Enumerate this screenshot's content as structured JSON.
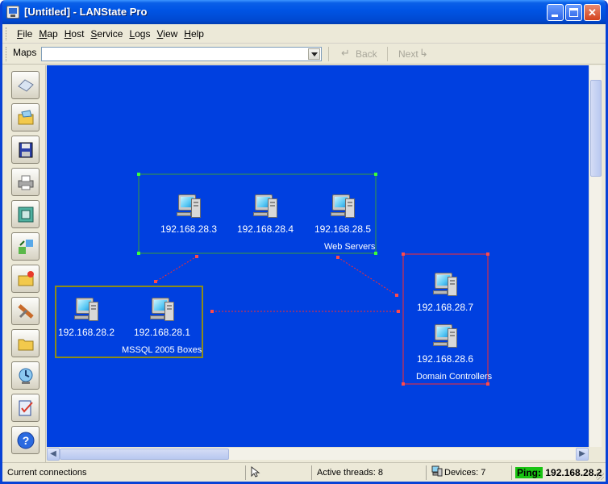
{
  "window": {
    "title": "[Untitled] - LANState Pro"
  },
  "menu": {
    "items": [
      {
        "accel": "F",
        "rest": "ile"
      },
      {
        "accel": "M",
        "rest": "ap"
      },
      {
        "accel": "H",
        "rest": "ost"
      },
      {
        "accel": "S",
        "rest": "ervice"
      },
      {
        "accel": "L",
        "rest": "ogs"
      },
      {
        "accel": "V",
        "rest": "iew"
      },
      {
        "accel": "H",
        "rest": "elp"
      }
    ]
  },
  "mapsbar": {
    "label": "Maps",
    "combo_value": "",
    "back_label": "Back",
    "next_label": "Next"
  },
  "toolbar": {
    "tools": [
      "new-map-icon",
      "open-map-icon",
      "save-map-icon",
      "print-icon",
      "fit-window-icon",
      "refresh-icon",
      "add-host-icon",
      "tools-icon",
      "folder-icon",
      "scan-network-icon",
      "checklist-icon",
      "help-icon"
    ]
  },
  "map": {
    "background": "#0040e0",
    "groups": [
      {
        "name": "Web Servers",
        "border_color": "#3a9b3a",
        "hosts": [
          "192.168.28.3",
          "192.168.28.4",
          "192.168.28.5"
        ]
      },
      {
        "name": "MSSQL 2005 Boxes",
        "border_color": "#8c8c18",
        "hosts": [
          "192.168.28.2",
          "192.168.28.1"
        ]
      },
      {
        "name": "Domain Controllers",
        "border_color": "#ff2a2a",
        "hosts": [
          "192.168.28.7",
          "192.168.28.6"
        ]
      }
    ],
    "link_color": "#ff2a2a"
  },
  "status": {
    "connections": "Current connections",
    "threads": "Active threads: 8",
    "devices": "Devices: 7",
    "ping_label": "Ping:",
    "ping_value": "192.168.28.2"
  }
}
